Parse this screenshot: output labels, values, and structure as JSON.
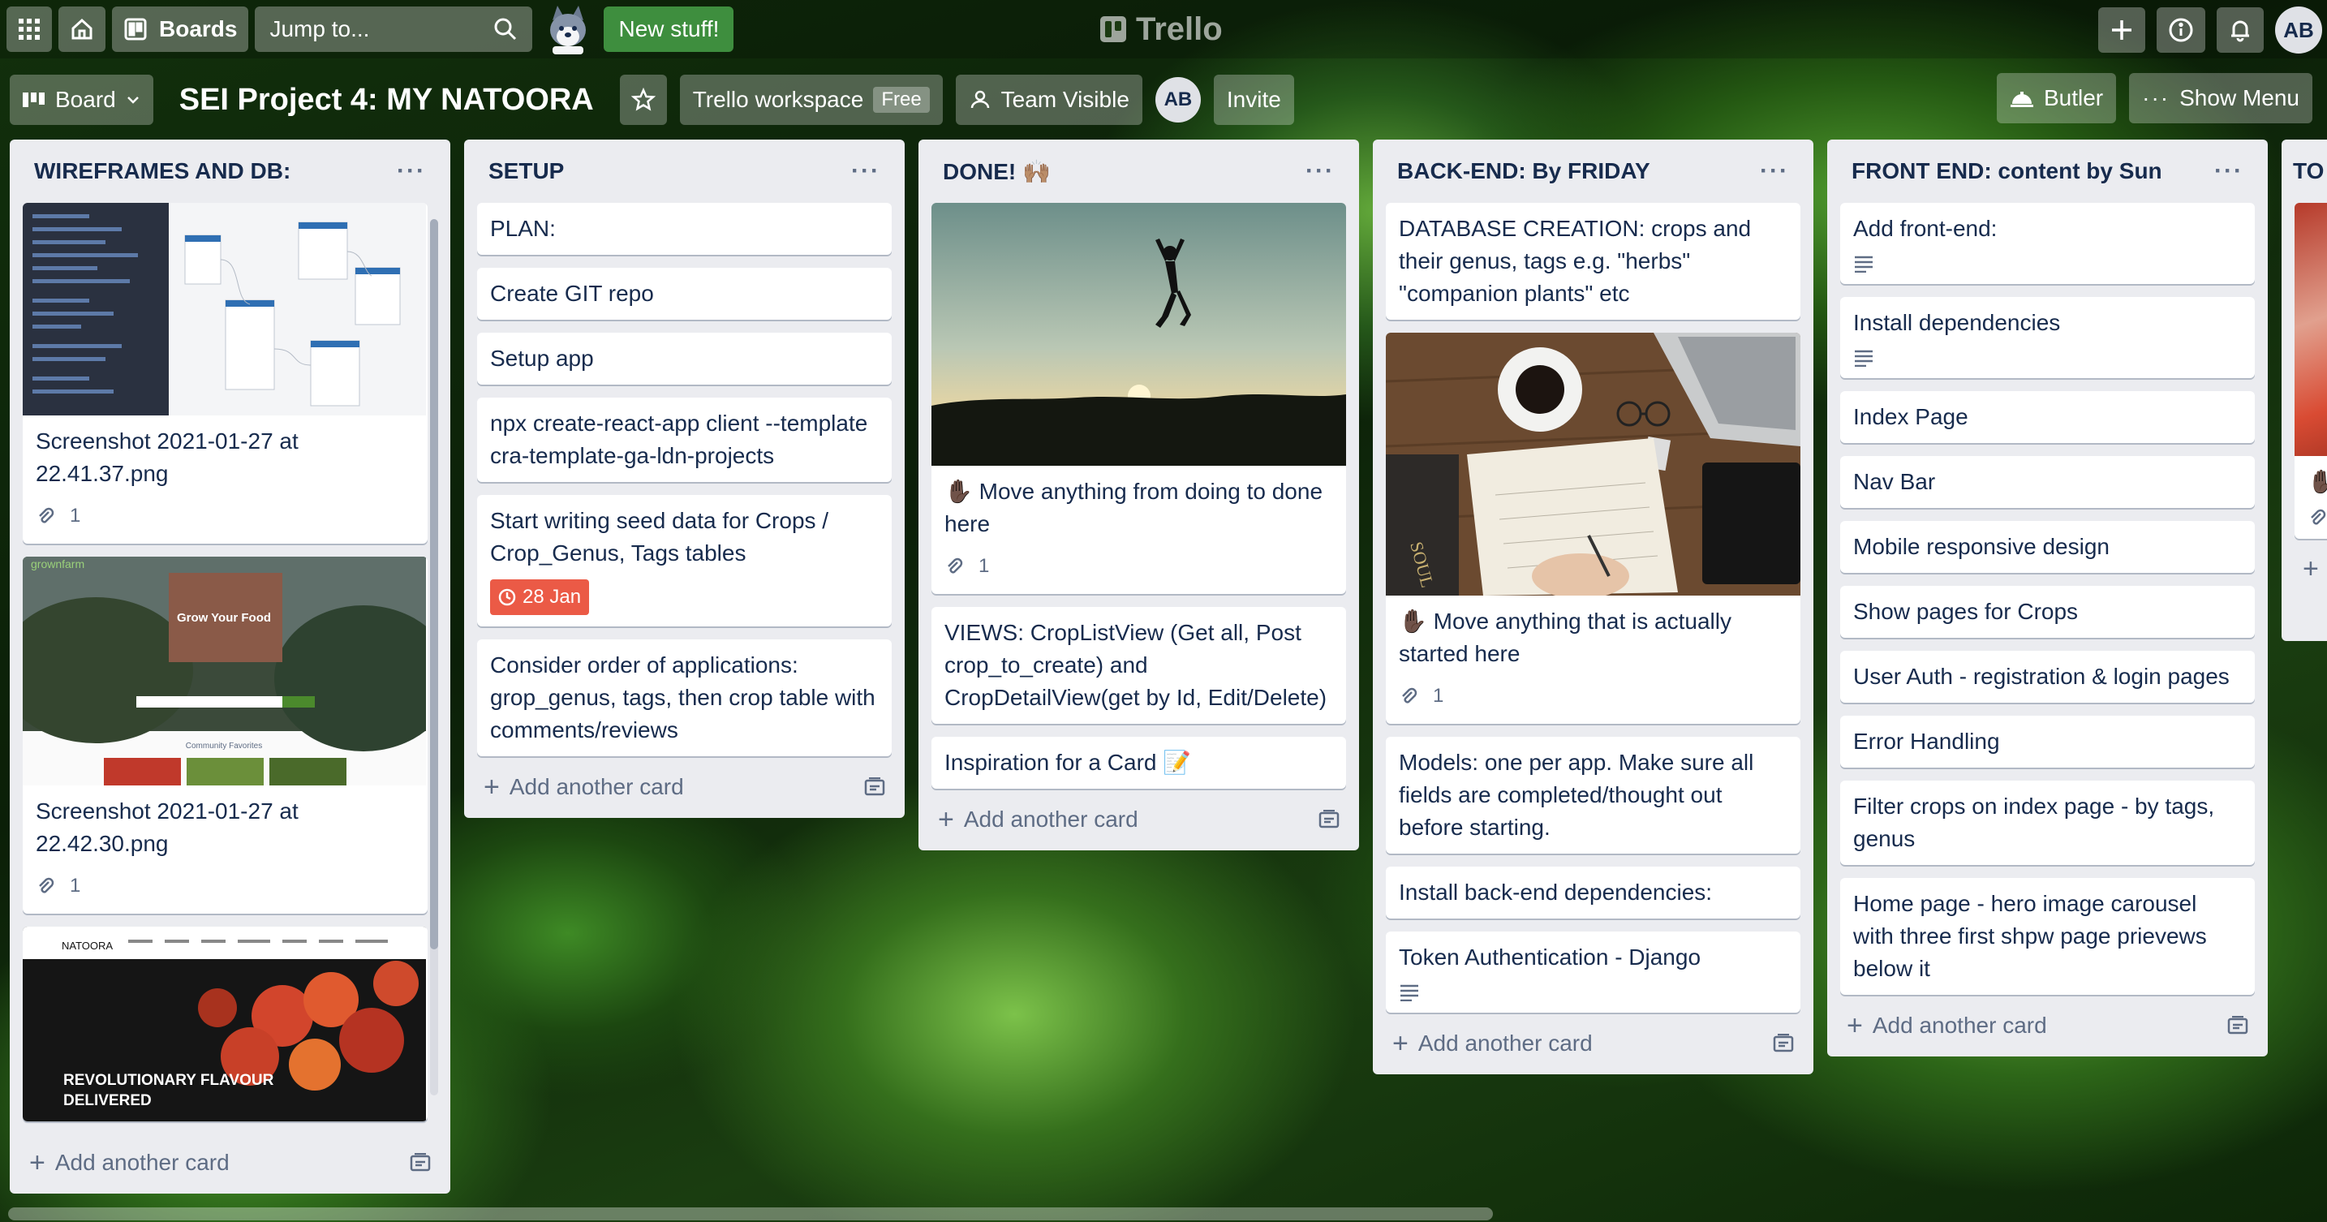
{
  "topbar": {
    "boards_label": "Boards",
    "search_placeholder": "Jump to...",
    "new_stuff_label": "New stuff!",
    "logo_text": "Trello",
    "avatar_initials": "AB"
  },
  "board_header": {
    "view_label": "Board",
    "title": "SEI Project 4: MY NATOORA",
    "workspace_label": "Trello workspace",
    "workspace_badge": "Free",
    "visibility_label": "Team Visible",
    "member_initials": "AB",
    "invite_label": "Invite",
    "butler_label": "Butler",
    "show_menu_label": "Show Menu"
  },
  "add_card_label": "Add another card",
  "lists": [
    {
      "title": "WIREFRAMES AND DB:",
      "cards": [
        {
          "text": "Screenshot 2021-01-27 at 22.41.37.png",
          "attachments": "1"
        },
        {
          "text": "Screenshot 2021-01-27 at 22.42.30.png",
          "attachments": "1",
          "cover_title": "Grow Your Food",
          "cover_sub": "Community Favorites",
          "cover_brand": "grownfarm"
        },
        {
          "cover_title": "REVOLUTIONARY FLAVOUR",
          "cover_sub": "DELIVERED",
          "cover_brand": "NATOORA"
        }
      ]
    },
    {
      "title": "SETUP",
      "cards": [
        {
          "text": "PLAN:"
        },
        {
          "text": "Create GIT repo"
        },
        {
          "text": "Setup app"
        },
        {
          "text": "npx create-react-app client --template cra-template-ga-ldn-projects"
        },
        {
          "text": "Start writing seed data for Crops / Crop_Genus, Tags tables",
          "due": "28 Jan"
        },
        {
          "text": "Consider order of applications: grop_genus, tags, then crop table with comments/reviews"
        }
      ]
    },
    {
      "title": "DONE! 🙌🏽",
      "cards": [
        {
          "text": "✋🏿 Move anything from doing to done here",
          "attachments": "1"
        },
        {
          "text": "VIEWS: CropListView (Get all, Post crop_to_create) and CropDetailView(get by Id, Edit/Delete)"
        },
        {
          "text": "Inspiration for a Card 📝"
        }
      ]
    },
    {
      "title": "BACK-END: By FRIDAY",
      "cards": [
        {
          "text": "DATABASE CREATION: crops and their genus, tags e.g. \"herbs\" \"companion plants\" etc"
        },
        {
          "text": "✋🏿 Move anything that is actually started here",
          "attachments": "1"
        },
        {
          "text": "Models: one per app. Make sure all fields are completed/thought out before starting."
        },
        {
          "text": "Install back-end dependencies:"
        },
        {
          "text": "Token Authentication - Django"
        }
      ]
    },
    {
      "title": "FRONT END: content by Sun",
      "cards": [
        {
          "text": "Add front-end:"
        },
        {
          "text": "Install dependencies"
        },
        {
          "text": "Index Page"
        },
        {
          "text": "Nav Bar"
        },
        {
          "text": "Mobile responsive design"
        },
        {
          "text": "Show pages for Crops"
        },
        {
          "text": "User Auth - registration & login pages"
        },
        {
          "text": "Error Handling"
        },
        {
          "text": "Filter crops on index page - by tags, genus"
        },
        {
          "text": "Home page - hero image carousel with three first shpw page prievews below it"
        }
      ]
    },
    {
      "title": "TO",
      "cards": [
        {
          "text": "✋🏿"
        }
      ]
    }
  ]
}
